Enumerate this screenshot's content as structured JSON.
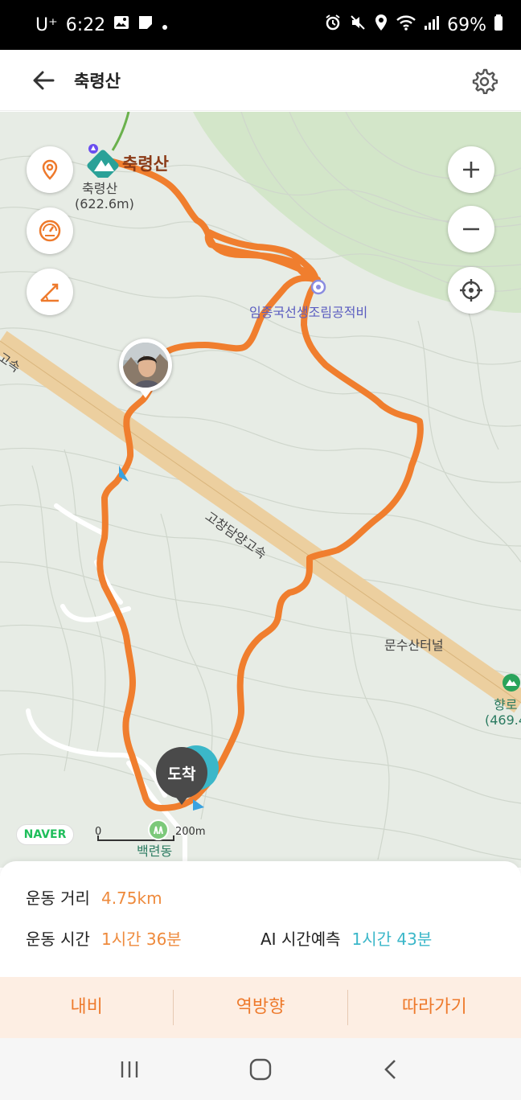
{
  "status_bar": {
    "carrier": "U⁺",
    "time": "6:22",
    "battery": "69%"
  },
  "header": {
    "title": "축령산"
  },
  "map": {
    "peak_name_large": "축령산",
    "peak_name": "축령산",
    "peak_elevation": "(622.6m)",
    "monument_label": "임종국선생조림공적비",
    "highway_label": "고창담양고속",
    "highway_label_left": "고속",
    "tunnel_label": "문수산터널",
    "peak2_name": "향로",
    "peak2_elevation": "(469.4",
    "village_label": "백련동",
    "arrival_label": "도착",
    "scale_zero": "0",
    "scale_value": "200m",
    "provider": "NAVER",
    "route_color": "#f07e2e"
  },
  "stats": {
    "distance_label": "운동 거리",
    "distance_value": "4.75km",
    "time_label": "운동 시간",
    "time_value": "1시간 36분",
    "ai_label": "AI 시간예측",
    "ai_value": "1시간 43분"
  },
  "actions": {
    "navi": "내비",
    "reverse": "역방향",
    "follow": "따라가기"
  }
}
